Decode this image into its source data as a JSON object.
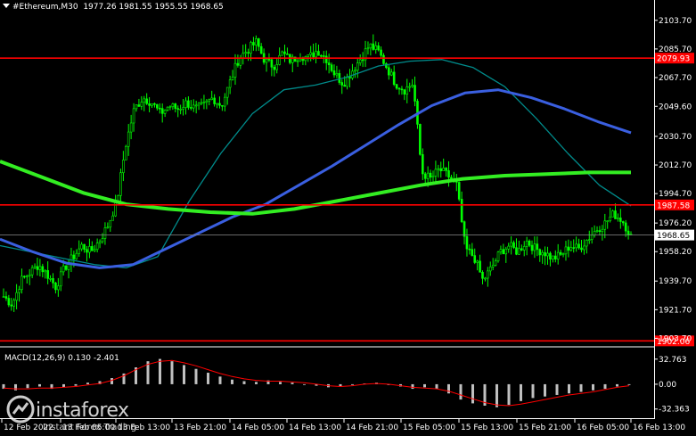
{
  "header": {
    "symbol": "#Ethereum,M30",
    "ohlc": "1977.26 1981.55 1955.55 1968.65"
  },
  "macd": {
    "label": "MACD(12,26,9) 0.130 -2.401",
    "ticks": [
      "32.763",
      "0.00",
      "-32.363"
    ]
  },
  "watermark": {
    "brand": "instaforex",
    "tagline": "Instant Forex Trading"
  },
  "colors": {
    "background": "#000000",
    "candle": "#00ff00",
    "ma_fast": "#008b8b",
    "ma_mid": "#3a5fe0",
    "ma_slow": "#33ee22",
    "level_line": "#ff0000",
    "level_label_bg": "#ff0000",
    "current_price_label_bg": "#ffffff",
    "macd_histogram": "#c0c0c0",
    "macd_signal": "#ff0000"
  },
  "chart_data": {
    "type": "candlestick",
    "instrument": "#Ethereum",
    "timeframe": "M30",
    "y_ticks": [
      "2103.70",
      "2085.70",
      "2067.70",
      "2049.60",
      "2030.70",
      "2012.70",
      "1994.70",
      "1976.20",
      "1958.20",
      "1939.70",
      "1921.70",
      "1903.70"
    ],
    "ylim": [
      1900,
      2112
    ],
    "x_labels": [
      "12 Feb 2022",
      "13 Feb 05:00",
      "13 Feb 13:00",
      "13 Feb 21:00",
      "14 Feb 05:00",
      "14 Feb 13:00",
      "14 Feb 21:00",
      "15 Feb 05:00",
      "15 Feb 13:00",
      "15 Feb 21:00",
      "16 Feb 05:00",
      "16 Feb 13:00"
    ],
    "levels": [
      {
        "label": "2079.93",
        "value": 2079.93
      },
      {
        "label": "1987.58",
        "value": 1987.58
      },
      {
        "label": "1902.06",
        "value": 1902.06
      }
    ],
    "current_price": {
      "label": "1968.65",
      "value": 1968.65
    },
    "close_path": [
      1930,
      1925,
      1940,
      1945,
      1950,
      1944,
      1936,
      1948,
      1955,
      1962,
      1958,
      1965,
      1975,
      1990,
      2025,
      2048,
      2055,
      2052,
      2045,
      2050,
      2048,
      2052,
      2048,
      2050,
      2055,
      2050,
      2065,
      2080,
      2085,
      2090,
      2078,
      2075,
      2083,
      2078,
      2082,
      2080,
      2085,
      2080,
      2070,
      2064,
      2072,
      2080,
      2088,
      2084,
      2074,
      2064,
      2060,
      2064,
      2008,
      2004,
      2010,
      2006,
      2000,
      1960,
      1955,
      1940,
      1948,
      1958,
      1962,
      1958,
      1965,
      1960,
      1958,
      1954,
      1956,
      1962,
      1960,
      1966,
      1972,
      1976,
      1982,
      1978,
      1968
    ],
    "ma_fast": [
      1962,
      1958,
      1954,
      1950,
      1948,
      1955,
      1990,
      2020,
      2045,
      2060,
      2063,
      2068,
      2075,
      2078,
      2079,
      2074,
      2062,
      2042,
      2020,
      2000,
      1987
    ],
    "ma_mid": [
      1966,
      1958,
      1951,
      1948,
      1950,
      1960,
      1970,
      1980,
      1988,
      2000,
      2012,
      2025,
      2038,
      2050,
      2058,
      2060,
      2055,
      2048,
      2040,
      2033
    ],
    "ma_slow": [
      2015,
      2005,
      1995,
      1988,
      1985,
      1983,
      1982,
      1985,
      1990,
      1995,
      2000,
      2004,
      2006,
      2007,
      2008,
      2008
    ],
    "macd": {
      "ylim": [
        -35,
        36
      ],
      "histogram": [
        -6,
        -8,
        -5,
        -3,
        -6,
        -4,
        -2,
        2,
        4,
        8,
        14,
        22,
        30,
        33,
        30,
        25,
        20,
        15,
        10,
        6,
        4,
        3,
        5,
        3,
        2,
        0,
        -2,
        -4,
        -3,
        -1,
        1,
        2,
        -1,
        -3,
        -6,
        -4,
        -6,
        -12,
        -20,
        -25,
        -28,
        -30,
        -27,
        -22,
        -18,
        -16,
        -14,
        -12,
        -10,
        -8,
        -6,
        -3,
        -1
      ],
      "signal": [
        -5,
        -6,
        -6,
        -5,
        -5,
        -4,
        -3,
        -1,
        1,
        5,
        11,
        19,
        26,
        30,
        31,
        28,
        24,
        19,
        14,
        10,
        7,
        5,
        4,
        4,
        3,
        2,
        0,
        -2,
        -3,
        -2,
        0,
        1,
        0,
        -2,
        -4,
        -5,
        -6,
        -9,
        -14,
        -19,
        -24,
        -27,
        -28,
        -26,
        -23,
        -20,
        -17,
        -14,
        -12,
        -10,
        -7,
        -4,
        -2
      ]
    }
  }
}
